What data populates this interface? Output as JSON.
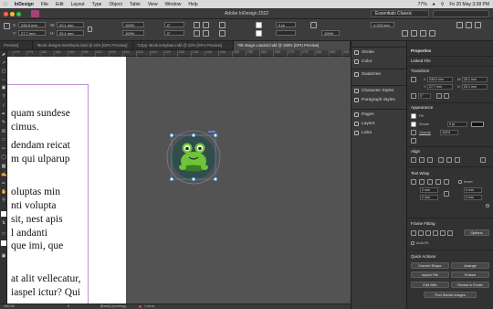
{
  "menubar": {
    "app": "InDesign",
    "items": [
      "File",
      "Edit",
      "Layout",
      "Type",
      "Object",
      "Table",
      "View",
      "Window",
      "Help"
    ],
    "battery": "77%",
    "datetime": "Fri 20 May 3:38 PM"
  },
  "window": {
    "title": "Adobe InDesign 2022",
    "workspace": "Essentials Classic"
  },
  "control": {
    "x_label": "X:",
    "x_value": "245.5 mm",
    "y_label": "Y:",
    "y_value": "27.7 mm",
    "w_label": "W:",
    "w_value": "20.1 mm",
    "h_label": "H:",
    "h_value": "20.1 mm",
    "scale_x": "100%",
    "scale_y": "100%",
    "angle": "0°",
    "shear": "0°",
    "stroke_weight": "0 pt",
    "opacity": "100%",
    "fit_value": "4.233 mm"
  },
  "tabs": [
    {
      "label": "Preview]",
      "active": false
    },
    {
      "label": "*Book designs Workbook.indd @ 42% [GPU Preview]",
      "active": false
    },
    {
      "label": "*12pp- Book template.indd @ 33% [GPU Preview]",
      "active": false
    },
    {
      "label": "*05 Image Loaded.indd @ 168% [GPU Preview]",
      "active": true
    }
  ],
  "ruler": [
    "170",
    "175",
    "180",
    "185",
    "190",
    "195",
    "200",
    "205",
    "210",
    "215",
    "220",
    "225",
    "230",
    "235",
    "240",
    "245",
    "250",
    "255",
    "260",
    "265",
    "270",
    "275",
    "280",
    "285",
    "290"
  ],
  "canvas": {
    "text_lines": [
      "quam sundese",
      "cimus.",
      "dendam reicat",
      "m qui ulparup",
      "oluptas min",
      "nti volupta",
      "sit, nest apis",
      "l andanti",
      "que imi, que",
      "at alit vellecatur,",
      "iaspel ictur? Qui"
    ]
  },
  "status": {
    "zoom": "160.58",
    "page": "3",
    "style": "[Basic] (working)",
    "errors": "1 error"
  },
  "dock": {
    "items": [
      "Stroke",
      "Color",
      "Swatches",
      "Character Styles",
      "Paragraph Styles",
      "Pages",
      "Layers",
      "Links"
    ]
  },
  "properties": {
    "title": "Properties",
    "object_type": "Linked File",
    "transform_heading": "Transform",
    "x_label": "X",
    "x_value": "245.5 mm",
    "y_label": "Y",
    "y_value": "27.7 mm",
    "w_label": "W",
    "w_value": "20.1 mm",
    "h_label": "H",
    "h_value": "20.1 mm",
    "angle": "0°",
    "appearance_heading": "Appearance",
    "fill_label": "Fill",
    "stroke_label": "Stroke",
    "stroke_weight": "0 pt",
    "opacity_label": "Opacity",
    "opacity_value": "100%",
    "align_heading": "Align",
    "textwrap_heading": "Text Wrap",
    "invert_label": "Invert",
    "wrap_top": "2 mm",
    "wrap_bottom": "2 mm",
    "wrap_left": "0 mm",
    "wrap_right": "0 mm",
    "frame_fitting_heading": "Frame Fitting",
    "options_label": "Options",
    "autofit_label": "Auto-Fit",
    "quick_actions_heading": "Quick Actions",
    "btn_convert": "Convert Shape",
    "btn_arrange": "Arrange",
    "btn_import": "Import File",
    "btn_embed": "Embed",
    "btn_edit": "Edit With",
    "btn_reveal": "Reveal in Finder",
    "btn_similar": "Find Similar Images"
  },
  "colors": {
    "frog_body": "#6fc43a",
    "frog_dark": "#3a7d24",
    "frog_circle": "#2f4e4c",
    "selection": "#4a90e2",
    "margin_guide": "#c18fd4"
  }
}
